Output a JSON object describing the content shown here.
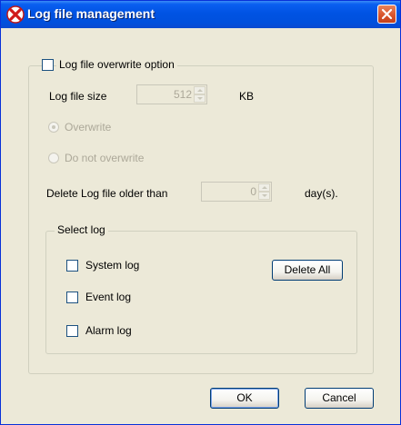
{
  "window": {
    "title": "Log file management",
    "app_icon": "red-x-logo-icon",
    "close_icon": "close-icon",
    "colors": {
      "titlebar": "#0053e3",
      "dialog_bg": "#ece9d8",
      "close_button": "#d7522a",
      "disabled_text": "#aca899"
    }
  },
  "overwrite_group": {
    "checkbox_label": "Log file overwrite option",
    "checked": false,
    "size_label": "Log file size",
    "size_value": "512",
    "size_unit": "KB",
    "radio_overwrite_label": "Overwrite",
    "radio_overwrite_checked": true,
    "radio_no_overwrite_label": "Do not overwrite",
    "radio_no_overwrite_checked": false
  },
  "delete_older": {
    "label": "Delete Log file older than",
    "value": "0",
    "unit": "day(s)."
  },
  "select_log": {
    "legend": "Select log",
    "items": [
      {
        "label": "System log",
        "checked": false
      },
      {
        "label": "Event log",
        "checked": false
      },
      {
        "label": "Alarm log",
        "checked": false
      }
    ],
    "delete_all_label": "Delete All"
  },
  "buttons": {
    "ok_label": "OK",
    "cancel_label": "Cancel"
  }
}
